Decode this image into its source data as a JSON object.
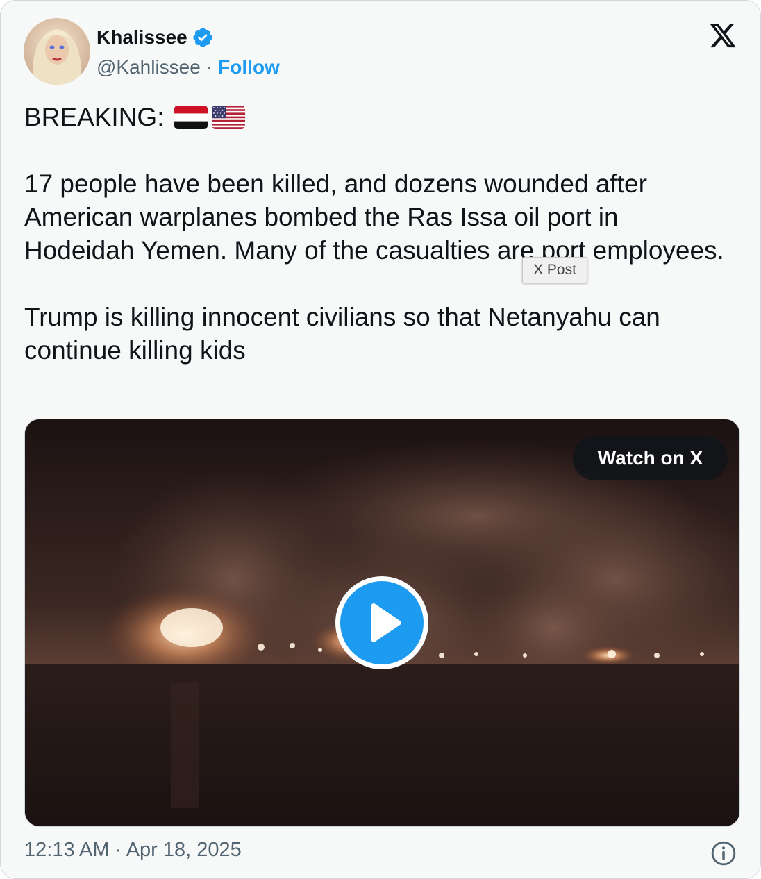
{
  "author": {
    "name": "Khalissee",
    "handle": "@Kahlissee",
    "separator": "·",
    "follow_label": "Follow"
  },
  "post": {
    "breaking": "BREAKING:",
    "flags": [
      "yemen-flag",
      "us-flag"
    ],
    "paragraph1": "17 people have been killed, and dozens wounded after American warplanes bombed the Ras Issa oil port in Hodeidah Yemen. Many of the casualties are port employees.",
    "paragraph2": "Trump is killing innocent civilians so that Netanyahu can continue killing kids"
  },
  "tooltip": "X Post",
  "media": {
    "watch_label": "Watch on X"
  },
  "timestamp": "12:13 AM · Apr 18, 2025",
  "icons": {
    "verified": "verified-badge-icon",
    "logo": "x-logo-icon",
    "play": "play-icon",
    "info": "info-icon"
  },
  "colors": {
    "accent": "#1d9bf0",
    "text": "#0f1419",
    "secondary": "#536471",
    "card_bg": "#f7f9f9"
  }
}
